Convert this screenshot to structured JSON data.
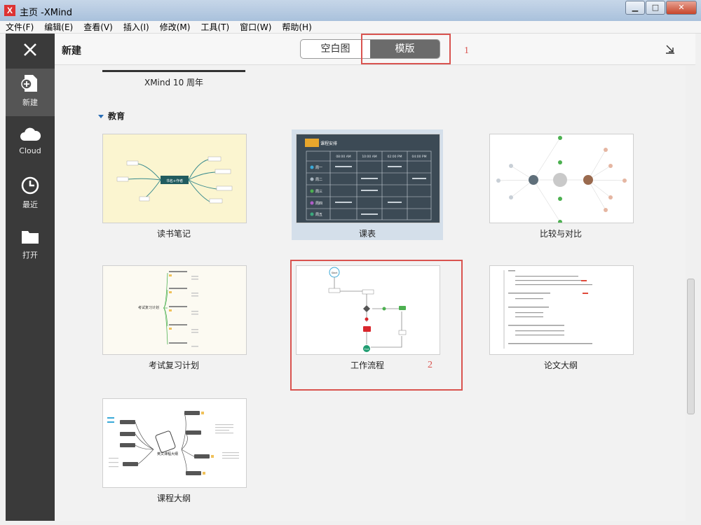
{
  "window": {
    "title": "主页 -XMind",
    "logo": "X",
    "minimize": "▁",
    "maximize": "□",
    "close": "✕"
  },
  "menu": [
    "文件(F)",
    "编辑(E)",
    "查看(V)",
    "插入(I)",
    "修改(M)",
    "工具(T)",
    "窗口(W)",
    "帮助(H)"
  ],
  "sidebar": {
    "items": [
      {
        "label": "新建",
        "icon": "new-file-icon"
      },
      {
        "label": "Cloud",
        "icon": "cloud-icon"
      },
      {
        "label": "最近",
        "icon": "clock-icon"
      },
      {
        "label": "打开",
        "icon": "folder-icon"
      }
    ]
  },
  "header": {
    "title": "新建",
    "tabs": [
      {
        "label": "空白图"
      },
      {
        "label": "模版"
      }
    ],
    "active_tab": "模版"
  },
  "annotations": {
    "one": "1",
    "two": "2"
  },
  "content": {
    "previous_item": "XMind 10 周年",
    "section": "教育",
    "templates": [
      {
        "label": "读书笔记"
      },
      {
        "label": "课表"
      },
      {
        "label": "比较与对比"
      },
      {
        "label": "考试复习计划"
      },
      {
        "label": "工作流程"
      },
      {
        "label": "论文大纲"
      },
      {
        "label": "课程大纲"
      }
    ]
  },
  "thumbnails": {
    "schedule_title": "课程安排",
    "schedule_times": [
      "08:00 AM",
      "10:00 AM",
      "02:00 PM",
      "04:00 PM"
    ],
    "schedule_days": [
      "周一",
      "周二",
      "周三",
      "周四",
      "周五"
    ],
    "reading_center": "书名+作者",
    "exam_center": "考试复习计划",
    "course_center": "英文课程大纲",
    "flow_start": "Start",
    "flow_end": "End"
  },
  "colors": {
    "accent": "#2a6db5",
    "annotation": "#d9534f",
    "sidebar": "#3a3a3a",
    "active_tab": "#6b6b6b"
  }
}
